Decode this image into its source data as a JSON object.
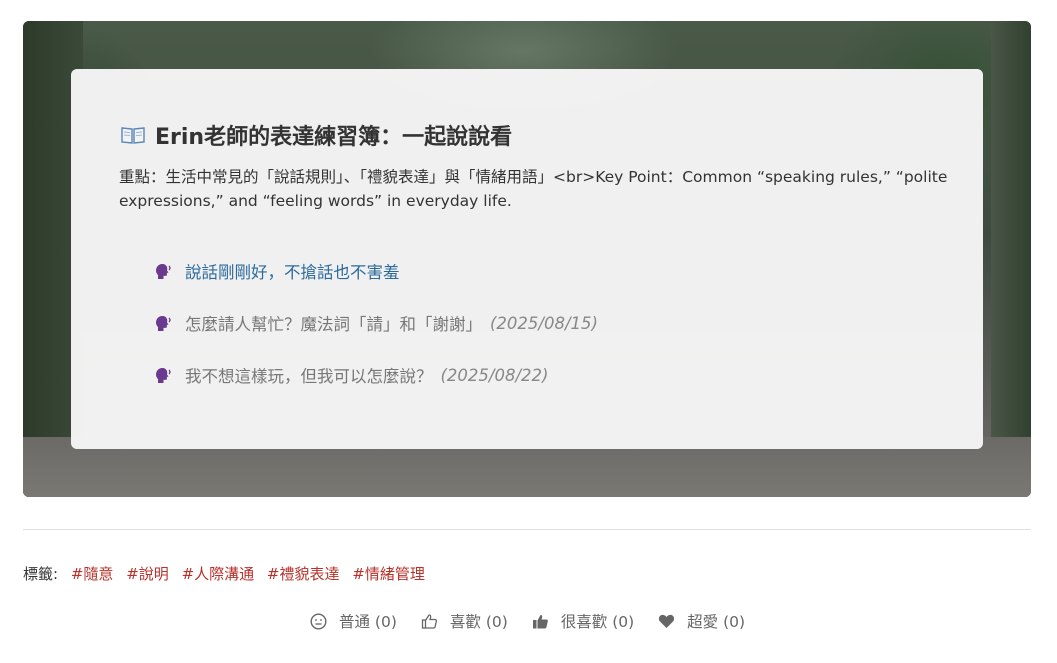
{
  "post": {
    "title_icon": "open-book-icon",
    "title": "Erin老師的表達練習簿：一起說說看",
    "description": "重點：生活中常見的「說話規則」、「禮貌表達」與「情緒用語」<br>Key Point：Common “speaking rules,” “polite expressions,” and “feeling words” in everyday life.",
    "items": [
      {
        "icon": "speaking-head-icon",
        "text": "說話剛剛好，不搶話也不害羞",
        "date": ""
      },
      {
        "icon": "speaking-head-icon",
        "text": "怎麼請人幫忙？魔法詞「請」和「謝謝」",
        "date": "(2025/08/15)"
      },
      {
        "icon": "speaking-head-icon",
        "text": "我不想這樣玩，但我可以怎麼說？",
        "date": "(2025/08/22)"
      }
    ]
  },
  "tags": {
    "label": "標籤:",
    "items": [
      "#隨意",
      "#說明",
      "#人際溝通",
      "#禮貌表達",
      "#情緒管理"
    ]
  },
  "reactions": [
    {
      "icon": "smiley-face-icon",
      "label": "普通 (0)"
    },
    {
      "icon": "thumbs-up-outline-icon",
      "label": "喜歡 (0)"
    },
    {
      "icon": "thumbs-up-filled-icon",
      "label": "很喜歡 (0)"
    },
    {
      "icon": "heart-icon",
      "label": "超愛 (0)"
    }
  ],
  "colors": {
    "link": "#2c6a9e",
    "tag": "#b8322b",
    "muted_text": "#777777"
  }
}
